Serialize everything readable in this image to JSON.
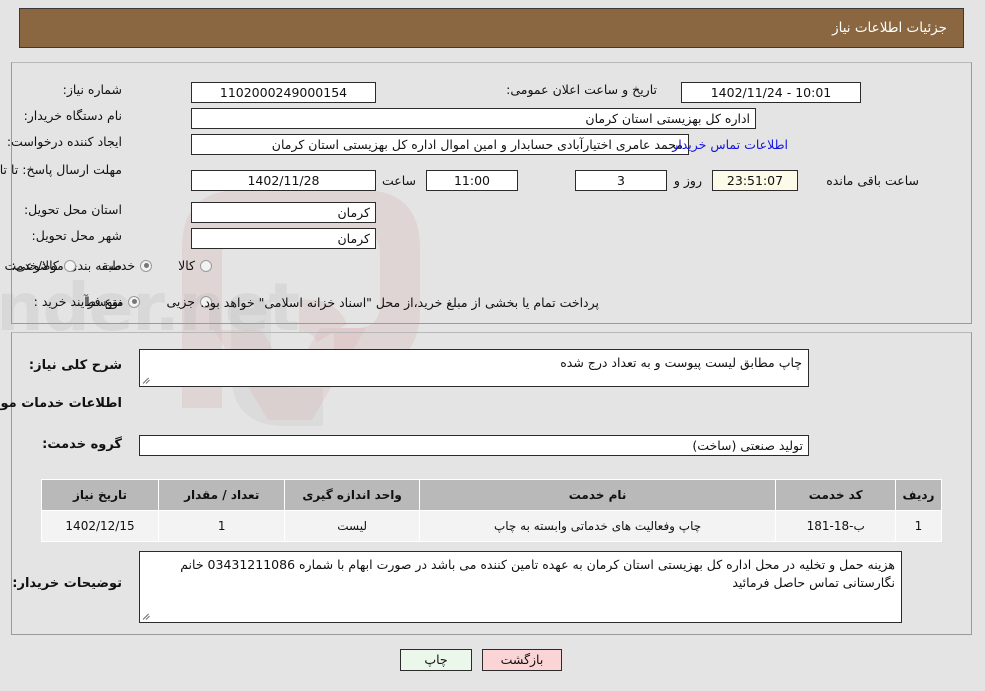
{
  "window": {
    "title": "جزئیات اطلاعات نیاز"
  },
  "need_info": {
    "need_number_label": "شماره نیاز:",
    "need_number_value": "1102000249000154",
    "announce_datetime_label": "تاریخ و ساعت اعلان عمومی:",
    "announce_datetime_value": "10:01 - 1402/11/24",
    "buyer_org_label": "نام دستگاه خریدار:",
    "buyer_org_value": "اداره کل بهزیستی استان کرمان",
    "requester_label": "ایجاد کننده درخواست:",
    "requester_value": "محمد عامری اختیارآبادی حسابدار و امین اموال اداره کل بهزیستی استان کرمان",
    "buyer_contact_link": "اطلاعات تماس خریدار",
    "deadline_label": "مهلت ارسال پاسخ: تا تاریخ:",
    "deadline_date": "1402/11/28",
    "deadline_time_label": "ساعت",
    "deadline_time": "11:00",
    "remaining_days": "3",
    "remaining_days_label": "روز و",
    "remaining_clock": "23:51:07",
    "remaining_suffix_label": "ساعت باقی مانده",
    "delivery_province_label": "استان محل تحویل:",
    "delivery_province_value": "کرمان",
    "delivery_city_label": "شهر محل تحویل:",
    "delivery_city_value": "کرمان",
    "category_label": "طبقه بندی موضوعی:",
    "category_options": [
      {
        "label": "کالا",
        "selected": false
      },
      {
        "label": "خدمت",
        "selected": true
      },
      {
        "label": "کالا/خدمت",
        "selected": false
      }
    ],
    "process_type_label": "نوع فرآیند خرید :",
    "process_type_options": [
      {
        "label": "جزیی",
        "selected": false
      },
      {
        "label": "متوسط",
        "selected": true
      }
    ],
    "process_type_note": "پرداخت تمام یا بخشی از مبلغ خرید،از محل \"اسناد خزانه اسلامی\" خواهد بود."
  },
  "general": {
    "description_label": "شرح کلی نیاز:",
    "description_value": "چاپ مطابق لیست پیوست و به تعداد درج شده",
    "services_section_title": "اطلاعات خدمات مورد نیاز",
    "service_group_label": "گروه خدمت:",
    "service_group_value": "تولید صنعتی (ساخت)"
  },
  "table": {
    "columns": [
      "ردیف",
      "کد خدمت",
      "نام خدمت",
      "واحد اندازه گیری",
      "تعداد / مقدار",
      "تاریخ نیاز"
    ],
    "rows": [
      {
        "row_no": "1",
        "service_code": "ب-18-181",
        "service_name": "چاپ وفعالیت های خدماتی وابسته به چاپ",
        "unit": "لیست",
        "quantity": "1",
        "need_date": "1402/12/15"
      }
    ]
  },
  "buyer_notes": {
    "label": "توضیحات خریدار:",
    "value": "هزینه حمل و تخلیه در محل اداره کل بهزیستی استان کرمان به عهده تامین کننده می باشد در صورت ابهام با شماره 03431211086 خانم نگارستانی تماس حاصل فرمائید"
  },
  "footer": {
    "print_label": "چاپ",
    "back_label": "بازگشت"
  },
  "colors": {
    "header_brown": "#8a6741",
    "page_bg": "#e4e4e4",
    "link_blue": "#1414dd",
    "table_header_gray": "#b9b9b9",
    "print_button_green": "#eaf7ea",
    "back_button_pink": "#fbd5d5",
    "countdown_cream": "#fbfbe8"
  }
}
